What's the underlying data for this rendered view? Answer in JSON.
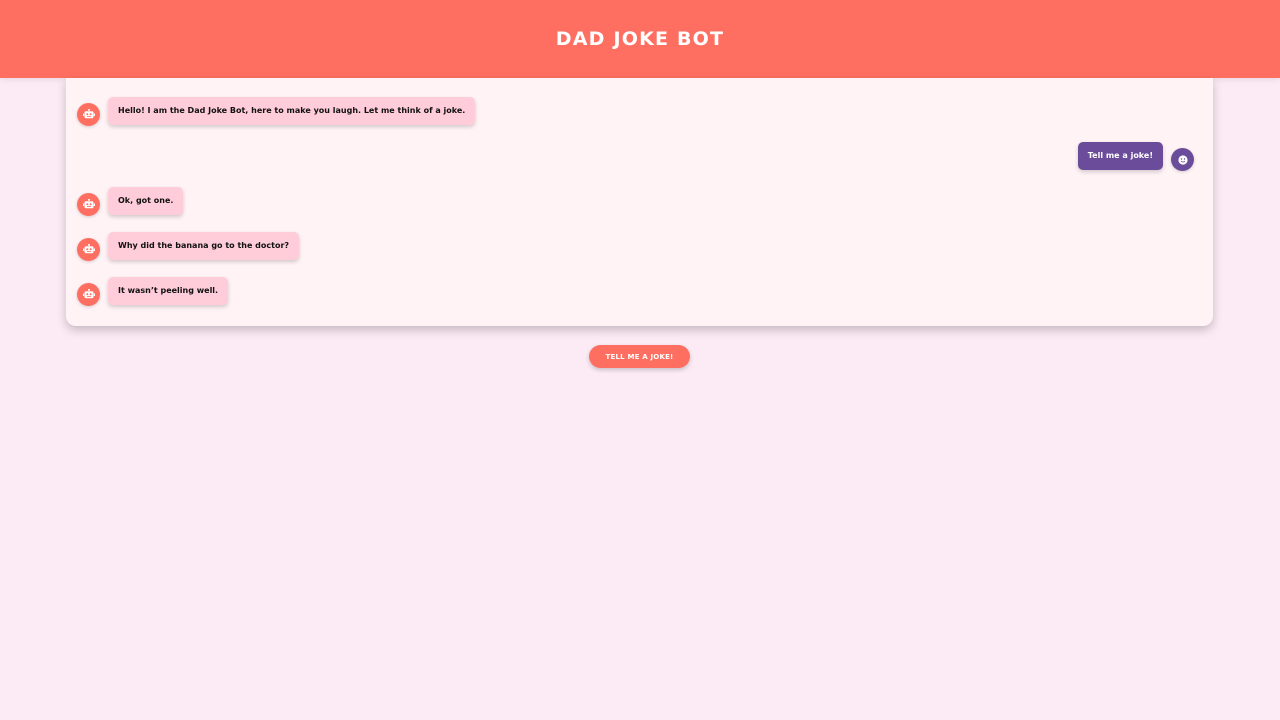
{
  "header": {
    "title": "DAD JOKE BOT"
  },
  "chat": {
    "messages": [
      {
        "sender": "bot",
        "avatar_icon": "robot-icon",
        "text": "Hello! I am the Dad Joke Bot, here to make you laugh. Let me think of a joke."
      },
      {
        "sender": "user",
        "avatar_icon": "smiley-face-icon",
        "text": "Tell me a joke!"
      },
      {
        "sender": "bot",
        "avatar_icon": "robot-icon",
        "text": "Ok, got one."
      },
      {
        "sender": "bot",
        "avatar_icon": "robot-icon",
        "text": "Why did the banana go to the doctor?"
      },
      {
        "sender": "bot",
        "avatar_icon": "robot-icon",
        "text": "It wasn’t peeling well."
      }
    ]
  },
  "actions": {
    "joke_button_label": "TELL ME A JOKE!"
  },
  "colors": {
    "accent": "#ff6f61",
    "user_bubble": "#6b4c9a",
    "bot_bubble": "#ffcdd9",
    "background": "#fcebf5"
  }
}
